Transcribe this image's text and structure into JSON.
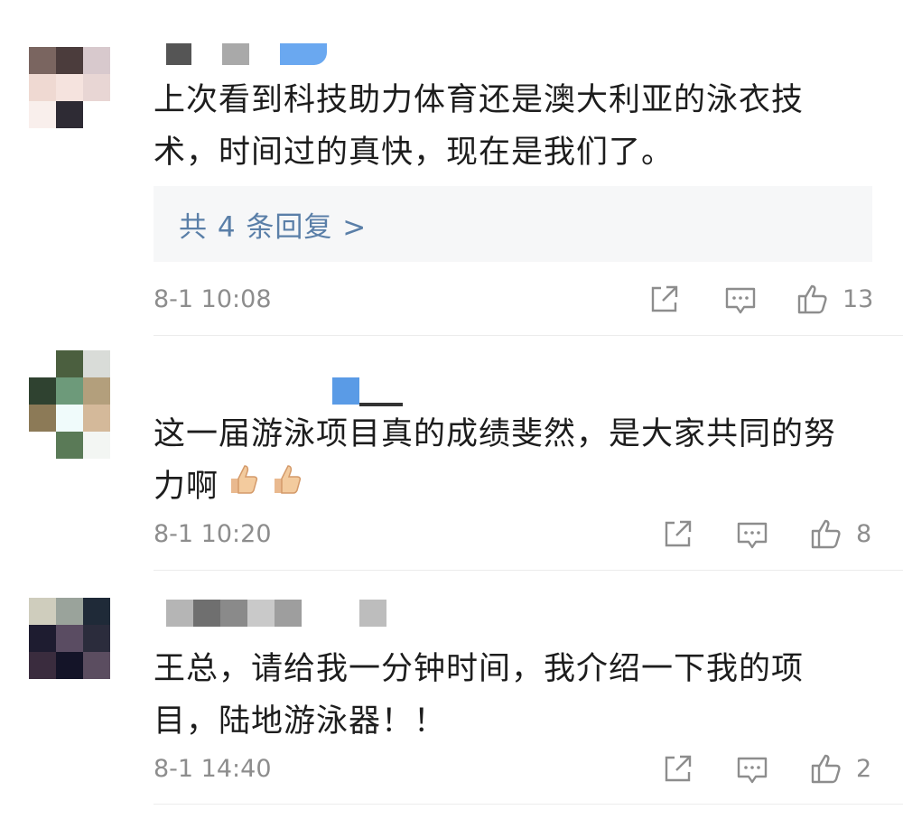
{
  "comments": [
    {
      "text": "上次看到科技助力体育还是澳大利亚的泳衣技术，时间过的真快，现在是我们了。",
      "replies_label": "共 4 条回复 >",
      "time": "8-1 10:08",
      "likes": "13",
      "avatar_colors": [
        "#f2e3df",
        "#efd9d2",
        "#d8c9cd",
        "#7a6560",
        "#4b3c3c",
        "#e8d6d4",
        "#f5e3de",
        "#f7e6e2",
        "#f9efec",
        "#ffffff",
        "#2e2b34",
        "#ffffff"
      ],
      "name_colors": [
        "#555555",
        "#a9a9a9",
        "#6aa8f0"
      ]
    },
    {
      "text": "这一届游泳项目真的成绩斐然，是大家共同的努力啊",
      "time": "8-1 10:20",
      "likes": "8",
      "avatar_colors": [
        "#ffffff",
        "#4b5f3f",
        "#d9dcd8",
        "#2f4230",
        "#6d9a7a",
        "#b39f7c",
        "#8c7a57",
        "#f0fbfb",
        "#d4b99a",
        "#ffffff",
        "#5a7a57",
        "#f3f6f3"
      ],
      "name_colors": [
        "#5a9be6",
        "#333333"
      ]
    },
    {
      "text": "王总，请给我一分钟时间，我介绍一下我的项目，陆地游泳器！！",
      "time": "8-1 14:40",
      "likes": "2",
      "avatar_colors": [
        "#cfcdbd",
        "#9aa39b",
        "#1f2a38",
        "#1e1c30",
        "#5a4c62",
        "#2b2c3c",
        "#3a2c3e",
        "#141428",
        "#5b4d60"
      ],
      "name_colors": [
        "#b5b5b5",
        "#6f6f6f",
        "#8a8a8a",
        "#c9c9c9",
        "#9e9e9e",
        "#bdbdbd"
      ]
    }
  ],
  "icons": {
    "share": "share-icon",
    "comment": "comment-icon",
    "like": "thumbs-up-icon",
    "emoji": "thumbs-up-emoji"
  },
  "colors": {
    "link": "#5a7fa8",
    "meta": "#8d8d8d"
  }
}
